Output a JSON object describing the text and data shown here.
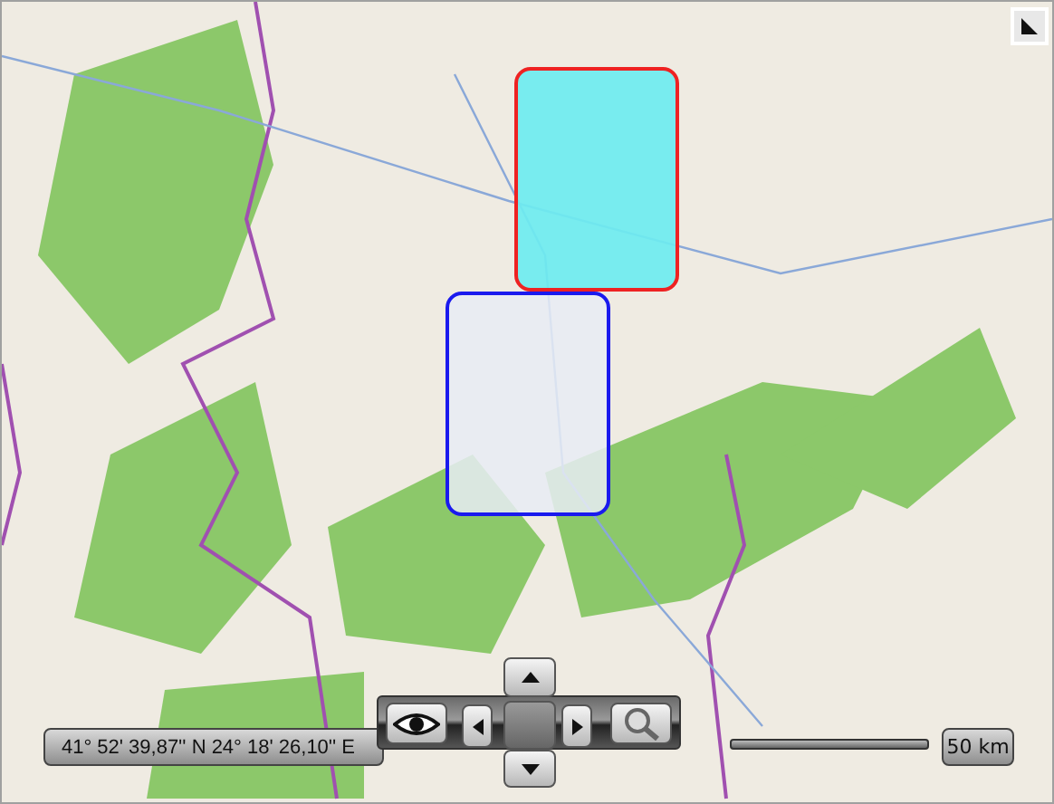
{
  "overlays": [
    {
      "color": "#ee2222"
    },
    {
      "color": "#1a1aee"
    }
  ],
  "coordinates": "41° 52' 39,87'' N 24° 18' 26,10'' E",
  "scale": {
    "label": "50 km"
  }
}
